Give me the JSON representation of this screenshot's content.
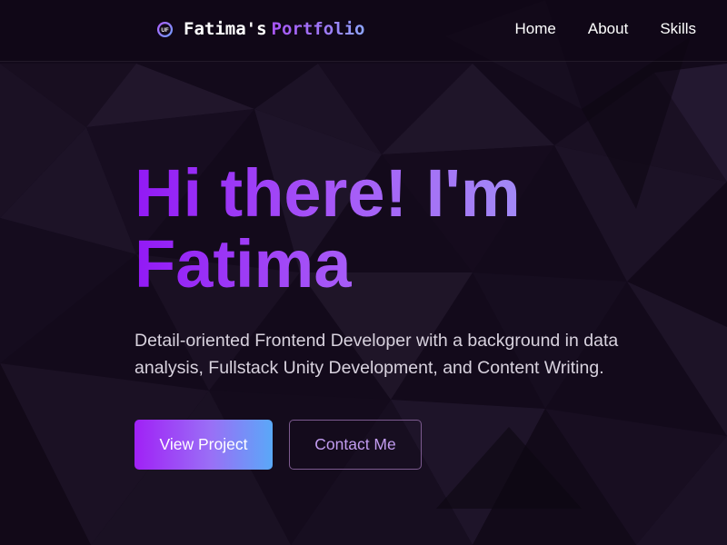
{
  "brand": {
    "logo_icon": "uf-logo-icon",
    "name": "Fatima's",
    "accent": "Portfolio"
  },
  "nav": {
    "items": [
      {
        "label": "Home"
      },
      {
        "label": "About"
      },
      {
        "label": "Skills"
      }
    ]
  },
  "hero": {
    "title_line1": "Hi there! I'm",
    "title_line2": "Fatima",
    "description": "Detail-oriented Frontend Developer with a background in data analysis, Fullstack Unity Development, and Content Writing."
  },
  "actions": {
    "primary_label": "View Project",
    "secondary_label": "Contact Me"
  },
  "colors": {
    "background": "#110818",
    "accent_purple": "#9219f5",
    "accent_blue": "#98a8ff",
    "secondary_text": "#c29cf0"
  }
}
